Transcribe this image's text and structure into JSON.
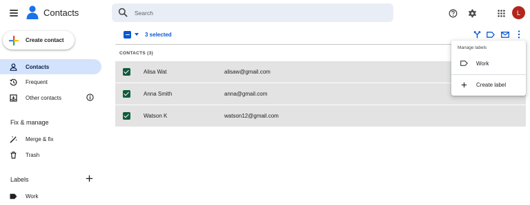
{
  "header": {
    "app_title": "Contacts",
    "search_placeholder": "Search",
    "avatar_initial": "L",
    "avatar_color": "#b3261e"
  },
  "sidebar": {
    "create_label": "Create contact",
    "items": [
      {
        "label": "Contacts",
        "icon": "person-icon",
        "active": true
      },
      {
        "label": "Frequent",
        "icon": "history-icon",
        "active": false
      },
      {
        "label": "Other contacts",
        "icon": "inbox-download-icon",
        "active": false
      }
    ],
    "fix_manage_heading": "Fix & manage",
    "fix_items": [
      {
        "label": "Merge & fix",
        "icon": "magic-wand-icon"
      },
      {
        "label": "Trash",
        "icon": "trash-icon"
      }
    ],
    "labels_heading": "Labels",
    "label_items": [
      {
        "label": "Work",
        "icon": "label-filled-icon"
      }
    ]
  },
  "toolbar": {
    "selected_text": "3 selected"
  },
  "list": {
    "header": "CONTACTS (3)",
    "rows": [
      {
        "name": "Alisa Wat",
        "email": "alisaw@gmail.com"
      },
      {
        "name": "Anna Smith",
        "email": "anna@gmail.com"
      },
      {
        "name": "Watson K",
        "email": "watson12@gmail.com"
      }
    ]
  },
  "menu": {
    "heading": "Manage labels",
    "items": [
      {
        "label": "Work",
        "icon": "label-outline-icon"
      },
      {
        "label": "Create label",
        "icon": "plus-icon"
      }
    ]
  },
  "colors": {
    "accent": "#0b57d0",
    "active_nav": "#d3e3fd",
    "selected_row": "#e3e3e3",
    "checkbox": "#0f5c3a"
  }
}
